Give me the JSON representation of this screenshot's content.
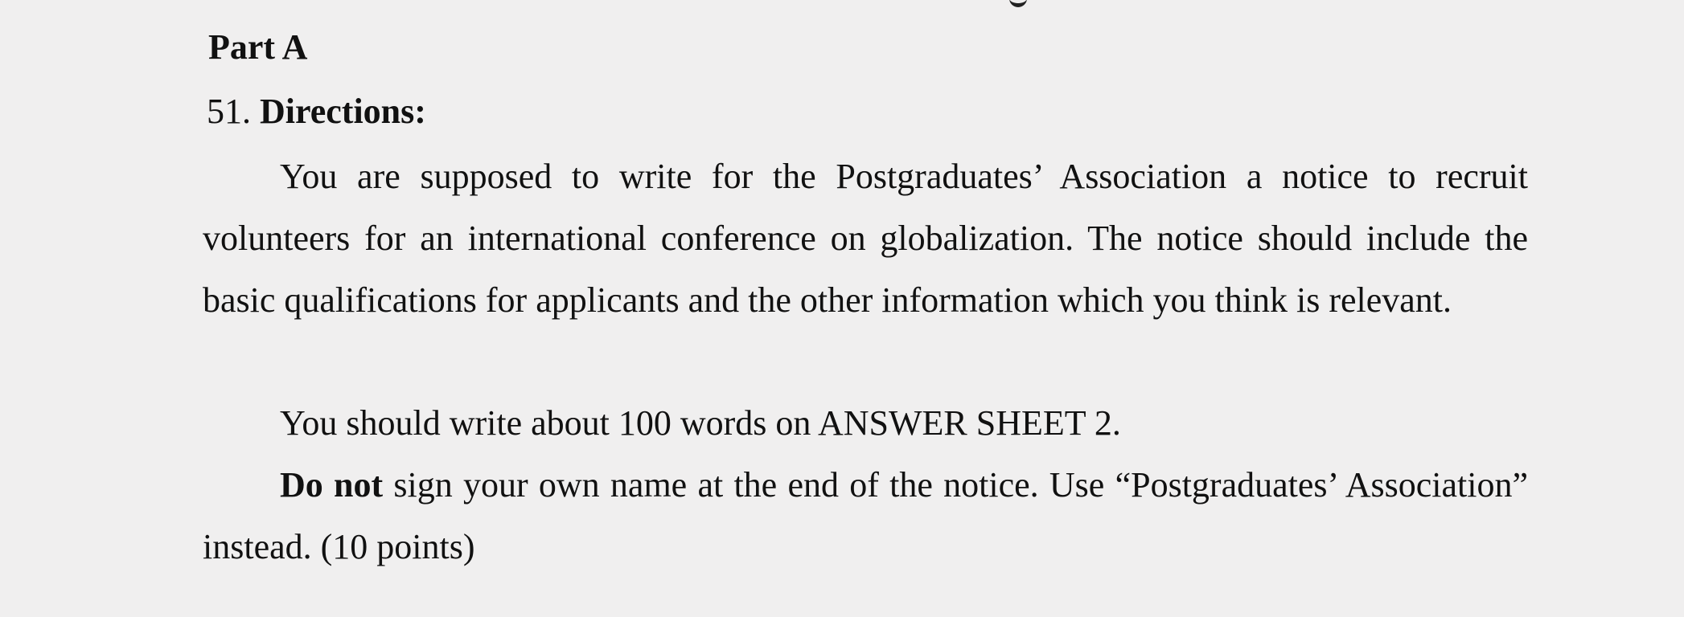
{
  "document": {
    "part_heading": "Part A",
    "question_number": "51.",
    "directions_label": "Directions:",
    "paragraph_1": "You are supposed to write for the Postgraduates’ Association a notice to recruit volunteers for an international conference on globalization. The notice should include the basic qualifications for applicants and the other information which you think is relevant.",
    "paragraph_2": "You should write about 100 words on ANSWER SHEET 2.",
    "paragraph_3_emphasis": "Do not",
    "paragraph_3_rest": " sign your own name at the end of the notice. Use “Postgraduates’ Association” instead. (10 points)"
  }
}
